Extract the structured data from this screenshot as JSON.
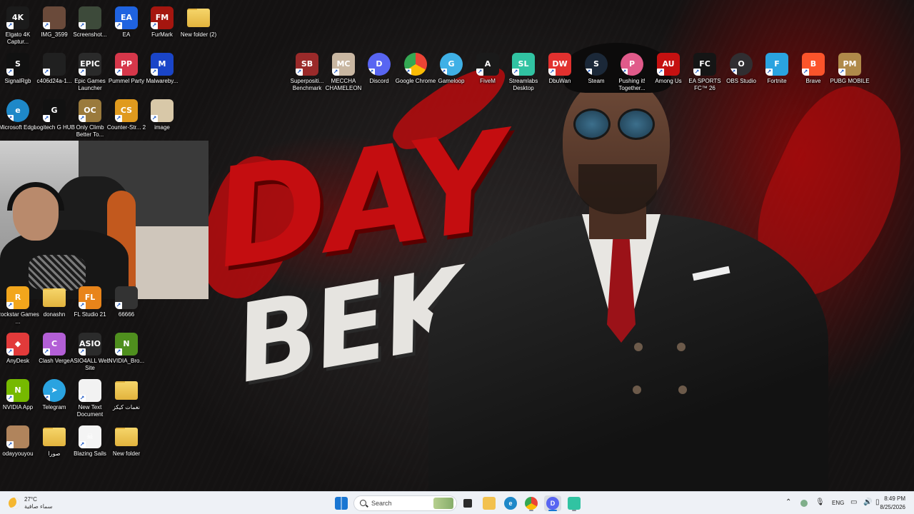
{
  "wallpaper": {
    "title_top": "DAY",
    "title_bottom": "BEK"
  },
  "desktop_icons": [
    {
      "label": "Elgato 4K Captur...",
      "glyph": "4K",
      "color": "#1b1b1b",
      "icon": "elgato-icon"
    },
    {
      "label": "IMG_3599",
      "glyph": "",
      "color": "#6a4a3a",
      "icon": "image-thumbnail-icon"
    },
    {
      "label": "Screenshot...",
      "glyph": "",
      "color": "#3d4a3a",
      "icon": "image-thumbnail-icon"
    },
    {
      "label": "EA",
      "glyph": "EA",
      "color": "#1f63e0",
      "icon": "ea-icon"
    },
    {
      "label": "FurMark",
      "glyph": "FM",
      "color": "#a5160f",
      "icon": "furmark-icon"
    },
    {
      "label": "New folder (2)",
      "glyph": "",
      "color": "#e2b33d",
      "icon": "folder-icon"
    },
    {
      "label": "SignalRgb",
      "glyph": "S",
      "color": "#111111",
      "icon": "signalrgb-icon"
    },
    {
      "label": "c406d24a-1...",
      "glyph": "",
      "color": "#202020",
      "icon": "file-thumbnail-icon"
    },
    {
      "label": "Epic Games Launcher",
      "glyph": "EPIC",
      "color": "#2a2a2a",
      "icon": "epic-games-icon"
    },
    {
      "label": "Pummel Party",
      "glyph": "PP",
      "color": "#d6374a",
      "icon": "pummel-party-icon"
    },
    {
      "label": "Malwareby...",
      "glyph": "M",
      "color": "#1a45c8",
      "icon": "malwarebytes-icon"
    },
    {
      "label": "Microsoft Edge",
      "glyph": "e",
      "color": "#1e88c8",
      "icon": "edge-icon"
    },
    {
      "label": "Logitech G HUB",
      "glyph": "G",
      "color": "#111111",
      "icon": "logitech-icon"
    },
    {
      "label": "Only Climb Better To...",
      "glyph": "OC",
      "color": "#9a7a3c",
      "icon": "only-climb-icon"
    },
    {
      "label": "Counter-Str... 2",
      "glyph": "CS",
      "color": "#e09a1e",
      "icon": "counter-strike-icon"
    },
    {
      "label": "image",
      "glyph": "",
      "color": "#d8c8a8",
      "icon": "image-file-icon"
    },
    {
      "label": "Rockstar Games ...",
      "glyph": "R",
      "color": "#f2a61c",
      "icon": "rockstar-icon"
    },
    {
      "label": "donashn",
      "glyph": "",
      "color": "#e2b33d",
      "icon": "folder-icon"
    },
    {
      "label": "FL Studio 21",
      "glyph": "FL",
      "color": "#e8841a",
      "icon": "fl-studio-icon"
    },
    {
      "label": "66666",
      "glyph": "",
      "color": "#333333",
      "icon": "file-icon"
    },
    {
      "label": "AnyDesk",
      "glyph": "◆",
      "color": "#e23a3a",
      "icon": "anydesk-icon"
    },
    {
      "label": "Clash Verge",
      "glyph": "C",
      "color": "#b35fd6",
      "icon": "clash-verge-icon"
    },
    {
      "label": "ASIO4ALL Web Site",
      "glyph": "ASIO",
      "color": "#2b2b2b",
      "icon": "asio-icon"
    },
    {
      "label": "NVIDIA_Bro...",
      "glyph": "N",
      "color": "#4f8f1e",
      "icon": "nvidia-icon"
    },
    {
      "label": "NVIDIA App",
      "glyph": "N",
      "color": "#76b900",
      "icon": "nvidia-icon"
    },
    {
      "label": "Telegram",
      "glyph": "➤",
      "color": "#2aa3e0",
      "icon": "telegram-icon"
    },
    {
      "label": "New Text Document",
      "glyph": "",
      "color": "#f2f2f2",
      "icon": "text-document-icon"
    },
    {
      "label": "نغمات كيكز",
      "glyph": "",
      "color": "#e2b33d",
      "icon": "folder-icon"
    },
    {
      "label": "odayyouyou",
      "glyph": "",
      "color": "#b0845c",
      "icon": "image-thumbnail-icon"
    },
    {
      "label": "صورا",
      "glyph": "",
      "color": "#e2b33d",
      "icon": "folder-icon"
    },
    {
      "label": "Blazing Sails",
      "glyph": "☠",
      "color": "#f4f4f4",
      "icon": "blazing-sails-icon"
    },
    {
      "label": "New folder",
      "glyph": "",
      "color": "#e2b33d",
      "icon": "folder-icon"
    },
    {
      "label": "Superpositi... Benchmark",
      "glyph": "SB",
      "color": "#9a2a2a",
      "icon": "superposition-icon"
    },
    {
      "label": "MECCHA CHAMELEON",
      "glyph": "MC",
      "color": "#c9b7a2",
      "icon": "meccha-chameleon-icon"
    },
    {
      "label": "Discord",
      "glyph": "D",
      "color": "#5865f2",
      "icon": "discord-icon"
    },
    {
      "label": "Google Chrome",
      "glyph": "",
      "color": "#4285f4",
      "icon": "chrome-icon"
    },
    {
      "label": "Gameloop",
      "glyph": "G",
      "color": "#3fb0e6",
      "icon": "gameloop-icon"
    },
    {
      "label": "FiveM",
      "glyph": "A",
      "color": "#1a1a1a",
      "icon": "fivem-icon"
    },
    {
      "label": "Streamlabs Desktop",
      "glyph": "SL",
      "color": "#31c3a2",
      "icon": "streamlabs-icon"
    },
    {
      "label": "DbuWan",
      "glyph": "DW",
      "color": "#e2312f",
      "icon": "dbuwan-icon"
    },
    {
      "label": "Steam",
      "glyph": "S",
      "color": "#1b2838",
      "icon": "steam-icon"
    },
    {
      "label": "Pushing it! Together...",
      "glyph": "P",
      "color": "#e05a8a",
      "icon": "pushing-it-icon"
    },
    {
      "label": "Among Us",
      "glyph": "AU",
      "color": "#c51111",
      "icon": "among-us-icon"
    },
    {
      "label": "EA SPORTS FC™ 26",
      "glyph": "FC",
      "color": "#151515",
      "icon": "ea-fc-icon"
    },
    {
      "label": "OBS Studio",
      "glyph": "O",
      "color": "#302e31",
      "icon": "obs-icon"
    },
    {
      "label": "Fortnite",
      "glyph": "F",
      "color": "#2aa3e0",
      "icon": "fortnite-icon"
    },
    {
      "label": "Brave",
      "glyph": "B",
      "color": "#fb542b",
      "icon": "brave-icon"
    },
    {
      "label": "PUBG MOBILE",
      "glyph": "PM",
      "color": "#b08a4a",
      "icon": "pubg-icon"
    }
  ],
  "taskbar": {
    "weather_temp": "27°C",
    "weather_desc": "سماء صافية",
    "search_placeholder": "Search",
    "language": "ENG",
    "time": "8:49 PM",
    "date": "8/25/2026",
    "apps": [
      {
        "name": "start",
        "color": "#1976d2"
      },
      {
        "name": "task-view",
        "color": "#2b2b2b"
      },
      {
        "name": "file-explorer",
        "color": "#f2c14e"
      },
      {
        "name": "edge",
        "color": "#1e88c8"
      },
      {
        "name": "chrome",
        "color": "#4285f4"
      },
      {
        "name": "discord",
        "color": "#5865f2"
      },
      {
        "name": "streamlabs",
        "color": "#31c3a2"
      }
    ]
  }
}
